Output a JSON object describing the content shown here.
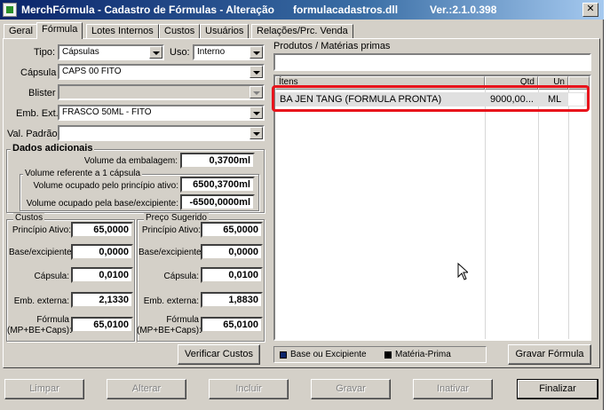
{
  "title": {
    "app": "MerchFórmula - Cadastro de Fórmulas - Alteração",
    "dll": "formulacadastros.dll",
    "version": "Ver.:2.1.0.398"
  },
  "tabs": [
    "Geral",
    "Fórmula",
    "Lotes Internos",
    "Custos",
    "Usuários",
    "Relações/Prc. Venda"
  ],
  "form": {
    "tipo_label": "Tipo:",
    "tipo_value": "Cápsulas",
    "uso_label": "Uso:",
    "uso_value": "Interno",
    "capsula_label": "Cápsula",
    "capsula_value": "CAPS 00 FITO",
    "blister_label": "Blister",
    "blister_value": "",
    "emb_ext_label": "Emb. Ext.",
    "emb_ext_value": "FRASCO 50ML - FITO",
    "val_padrao_label": "Val. Padrão",
    "val_padrao_value": ""
  },
  "dados_adicionais": {
    "title": "Dados adicionais",
    "vol_embalagem_label": "Volume da embalagem:",
    "vol_embalagem_value": "0,3700ml",
    "vol_ref_title": "Volume referente a 1 cápsula",
    "vol_principio_label": "Volume ocupado pelo princípio ativo:",
    "vol_principio_value": "6500,3700ml",
    "vol_base_label": "Volume ocupado pela base/excipiente:",
    "vol_base_value": "-6500,0000ml"
  },
  "custos": {
    "title": "Custos",
    "principio_label": "Princípio Ativo:",
    "principio_value": "65,0000",
    "base_label": "Base/excipiente:",
    "base_value": "0,0000",
    "capsula_label": "Cápsula:",
    "capsula_value": "0,0100",
    "emb_label": "Emb. externa:",
    "emb_value": "2,1330",
    "formula_label_1": "Fórmula",
    "formula_label_2": "(MP+BE+Caps):",
    "formula_value": "65,0100"
  },
  "preco_sugerido": {
    "title": "Preço Sugerido",
    "principio_label": "Princípio Ativo:",
    "principio_value": "65,0000",
    "base_label": "Base/excipiente:",
    "base_value": "0,0000",
    "capsula_label": "Cápsula:",
    "capsula_value": "0,0100",
    "emb_label": "Emb. externa:",
    "emb_value": "1,8830",
    "formula_label_1": "Fórmula",
    "formula_label_2": "(MP+BE+Caps):",
    "formula_value": "65,0100"
  },
  "buttons": {
    "verificar_custos": "Verificar Custos",
    "gravar_formula": "Gravar Fórmula",
    "limpar": "Limpar",
    "alterar": "Alterar",
    "incluir": "Incluir",
    "gravar": "Gravar",
    "inativar": "Inativar",
    "finalizar": "Finalizar"
  },
  "produtos": {
    "title": "Produtos / Matérias primas",
    "search_value": "",
    "columns": [
      "Ítens",
      "Qtd",
      "Un"
    ],
    "rows": [
      {
        "item": "BA JEN TANG (FORMULA PRONTA)",
        "qtd": "9000,00...",
        "un": "ML"
      }
    ]
  },
  "legend": {
    "base": "Base ou Excipiente",
    "base_color": "#0a246a",
    "materia": "Matéria-Prima",
    "materia_color": "#000000"
  },
  "colors": {
    "titlebar": "#0a246a",
    "highlight": "#e8141c"
  }
}
